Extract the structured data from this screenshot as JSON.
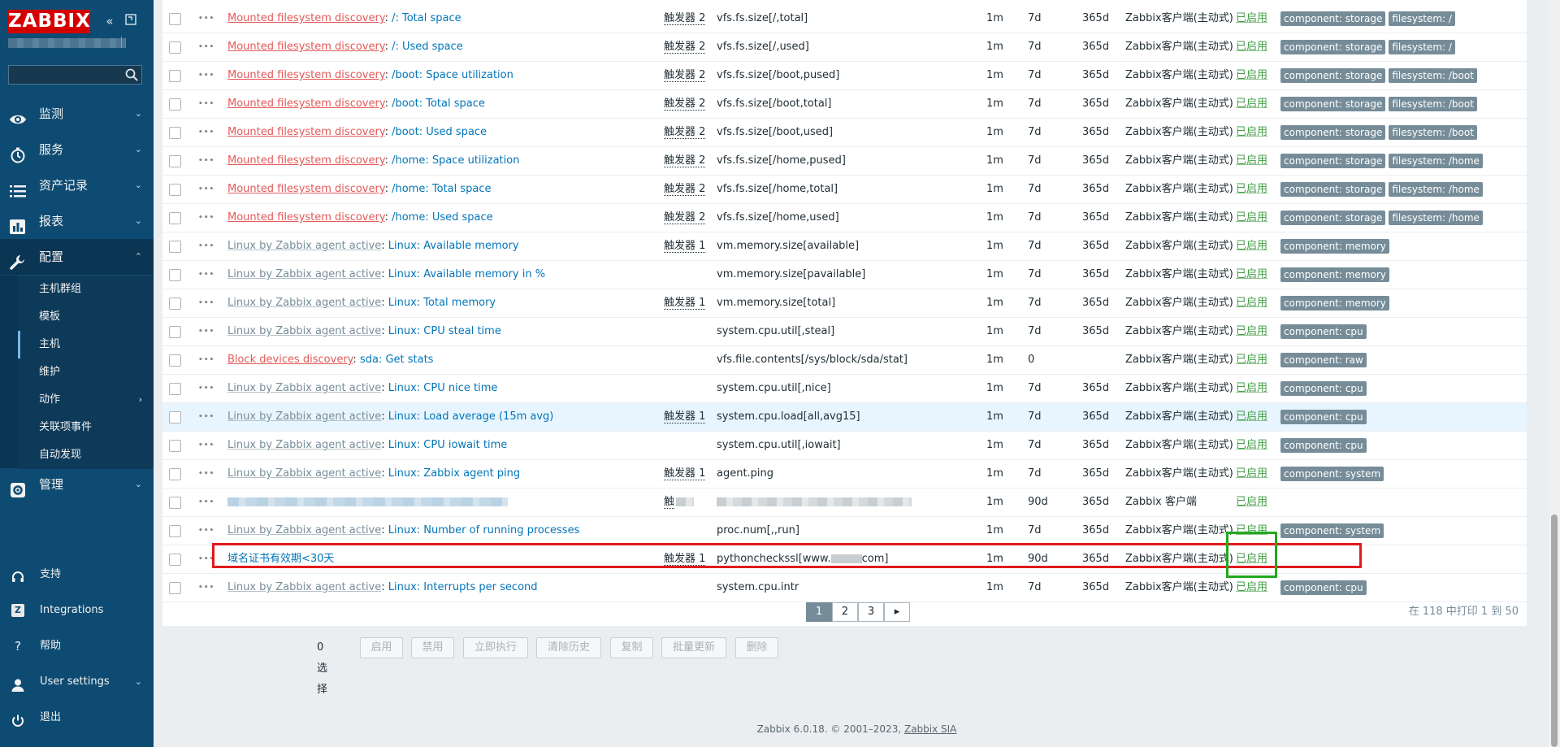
{
  "sidebar": {
    "logo": "ZABBIX",
    "nav": [
      {
        "label": "监测",
        "icon": "eye-icon"
      },
      {
        "label": "服务",
        "icon": "clock-icon"
      },
      {
        "label": "资产记录",
        "icon": "list-icon"
      },
      {
        "label": "报表",
        "icon": "bar-chart-icon"
      },
      {
        "label": "配置",
        "icon": "wrench-icon"
      },
      {
        "label": "管理",
        "icon": "gear-icon"
      }
    ],
    "config_submenu": [
      {
        "label": "主机群组"
      },
      {
        "label": "模板"
      },
      {
        "label": "主机"
      },
      {
        "label": "维护"
      },
      {
        "label": "动作"
      },
      {
        "label": "关联项事件"
      },
      {
        "label": "自动发现"
      }
    ],
    "bottom": [
      {
        "label": "支持",
        "icon": "headset-icon"
      },
      {
        "label": "Integrations",
        "icon": "z-logo-icon"
      },
      {
        "label": "帮助",
        "icon": "question-icon"
      },
      {
        "label": "User settings",
        "icon": "user-icon"
      },
      {
        "label": "退出",
        "icon": "power-icon"
      }
    ]
  },
  "rows": [
    {
      "prefix": "Mounted filesystem discovery",
      "prefix_color": "red",
      "name": "/: Total space",
      "triggers": "触发器 2",
      "key": "vfs.fs.size[/,total]",
      "interval": "1m",
      "history": "7d",
      "trends": "365d",
      "type": "Zabbix客户端(主动式)",
      "status": "已启用",
      "tags": [
        "component: storage",
        "filesystem: /"
      ]
    },
    {
      "prefix": "Mounted filesystem discovery",
      "prefix_color": "red",
      "name": "/: Used space",
      "triggers": "触发器 2",
      "key": "vfs.fs.size[/,used]",
      "interval": "1m",
      "history": "7d",
      "trends": "365d",
      "type": "Zabbix客户端(主动式)",
      "status": "已启用",
      "tags": [
        "component: storage",
        "filesystem: /"
      ]
    },
    {
      "prefix": "Mounted filesystem discovery",
      "prefix_color": "red",
      "name": "/boot: Space utilization",
      "triggers": "触发器 2",
      "key": "vfs.fs.size[/boot,pused]",
      "interval": "1m",
      "history": "7d",
      "trends": "365d",
      "type": "Zabbix客户端(主动式)",
      "status": "已启用",
      "tags": [
        "component: storage",
        "filesystem: /boot"
      ]
    },
    {
      "prefix": "Mounted filesystem discovery",
      "prefix_color": "red",
      "name": "/boot: Total space",
      "triggers": "触发器 2",
      "key": "vfs.fs.size[/boot,total]",
      "interval": "1m",
      "history": "7d",
      "trends": "365d",
      "type": "Zabbix客户端(主动式)",
      "status": "已启用",
      "tags": [
        "component: storage",
        "filesystem: /boot"
      ]
    },
    {
      "prefix": "Mounted filesystem discovery",
      "prefix_color": "red",
      "name": "/boot: Used space",
      "triggers": "触发器 2",
      "key": "vfs.fs.size[/boot,used]",
      "interval": "1m",
      "history": "7d",
      "trends": "365d",
      "type": "Zabbix客户端(主动式)",
      "status": "已启用",
      "tags": [
        "component: storage",
        "filesystem: /boot"
      ]
    },
    {
      "prefix": "Mounted filesystem discovery",
      "prefix_color": "red",
      "name": "/home: Space utilization",
      "triggers": "触发器 2",
      "key": "vfs.fs.size[/home,pused]",
      "interval": "1m",
      "history": "7d",
      "trends": "365d",
      "type": "Zabbix客户端(主动式)",
      "status": "已启用",
      "tags": [
        "component: storage",
        "filesystem: /home"
      ]
    },
    {
      "prefix": "Mounted filesystem discovery",
      "prefix_color": "red",
      "name": "/home: Total space",
      "triggers": "触发器 2",
      "key": "vfs.fs.size[/home,total]",
      "interval": "1m",
      "history": "7d",
      "trends": "365d",
      "type": "Zabbix客户端(主动式)",
      "status": "已启用",
      "tags": [
        "component: storage",
        "filesystem: /home"
      ]
    },
    {
      "prefix": "Mounted filesystem discovery",
      "prefix_color": "red",
      "name": "/home: Used space",
      "triggers": "触发器 2",
      "key": "vfs.fs.size[/home,used]",
      "interval": "1m",
      "history": "7d",
      "trends": "365d",
      "type": "Zabbix客户端(主动式)",
      "status": "已启用",
      "tags": [
        "component: storage",
        "filesystem: /home"
      ]
    },
    {
      "prefix": "Linux by Zabbix agent active",
      "prefix_color": "grey",
      "name": "Linux: Available memory",
      "triggers": "触发器 1",
      "key": "vm.memory.size[available]",
      "interval": "1m",
      "history": "7d",
      "trends": "365d",
      "type": "Zabbix客户端(主动式)",
      "status": "已启用",
      "tags": [
        "component: memory"
      ]
    },
    {
      "prefix": "Linux by Zabbix agent active",
      "prefix_color": "grey",
      "name": "Linux: Available memory in %",
      "triggers": "",
      "key": "vm.memory.size[pavailable]",
      "interval": "1m",
      "history": "7d",
      "trends": "365d",
      "type": "Zabbix客户端(主动式)",
      "status": "已启用",
      "tags": [
        "component: memory"
      ]
    },
    {
      "prefix": "Linux by Zabbix agent active",
      "prefix_color": "grey",
      "name": "Linux: Total memory",
      "triggers": "触发器 1",
      "key": "vm.memory.size[total]",
      "interval": "1m",
      "history": "7d",
      "trends": "365d",
      "type": "Zabbix客户端(主动式)",
      "status": "已启用",
      "tags": [
        "component: memory"
      ]
    },
    {
      "prefix": "Linux by Zabbix agent active",
      "prefix_color": "grey",
      "name": "Linux: CPU steal time",
      "triggers": "",
      "key": "system.cpu.util[,steal]",
      "interval": "1m",
      "history": "7d",
      "trends": "365d",
      "type": "Zabbix客户端(主动式)",
      "status": "已启用",
      "tags": [
        "component: cpu"
      ]
    },
    {
      "prefix": "Block devices discovery",
      "prefix_color": "red",
      "name": "sda: Get stats",
      "triggers": "",
      "key": "vfs.file.contents[/sys/block/sda/stat]",
      "interval": "1m",
      "history": "0",
      "trends": "",
      "type": "Zabbix客户端(主动式)",
      "status": "已启用",
      "tags": [
        "component: raw"
      ]
    },
    {
      "prefix": "Linux by Zabbix agent active",
      "prefix_color": "grey",
      "name": "Linux: CPU nice time",
      "triggers": "",
      "key": "system.cpu.util[,nice]",
      "interval": "1m",
      "history": "7d",
      "trends": "365d",
      "type": "Zabbix客户端(主动式)",
      "status": "已启用",
      "tags": [
        "component: cpu"
      ]
    },
    {
      "prefix": "Linux by Zabbix agent active",
      "prefix_color": "grey",
      "name": "Linux: Load average (15m avg)",
      "triggers": "触发器 1",
      "key": "system.cpu.load[all,avg15]",
      "interval": "1m",
      "history": "7d",
      "trends": "365d",
      "type": "Zabbix客户端(主动式)",
      "status": "已启用",
      "tags": [
        "component: cpu"
      ],
      "highlight": true
    },
    {
      "prefix": "Linux by Zabbix agent active",
      "prefix_color": "grey",
      "name": "Linux: CPU iowait time",
      "triggers": "",
      "key": "system.cpu.util[,iowait]",
      "interval": "1m",
      "history": "7d",
      "trends": "365d",
      "type": "Zabbix客户端(主动式)",
      "status": "已启用",
      "tags": [
        "component: cpu"
      ]
    },
    {
      "prefix": "Linux by Zabbix agent active",
      "prefix_color": "grey",
      "name": "Linux: Zabbix agent ping",
      "triggers": "触发器 1",
      "key": "agent.ping",
      "interval": "1m",
      "history": "7d",
      "trends": "365d",
      "type": "Zabbix客户端(主动式)",
      "status": "已启用",
      "tags": [
        "component: system"
      ]
    },
    {
      "prefix": "",
      "prefix_color": "blurred",
      "name": "",
      "triggers": "触",
      "key": "",
      "interval": "1m",
      "history": "90d",
      "trends": "365d",
      "type": "Zabbix 客户端",
      "status": "已启用",
      "tags": [],
      "blurred": true
    },
    {
      "prefix": "Linux by Zabbix agent active",
      "prefix_color": "grey",
      "name": "Linux: Number of running processes",
      "triggers": "",
      "key": "proc.num[,,run]",
      "interval": "1m",
      "history": "7d",
      "trends": "365d",
      "type": "Zabbix客户端(主动式)",
      "status": "已启用",
      "tags": [
        "component: system"
      ]
    },
    {
      "prefix": "",
      "prefix_color": "none",
      "name": "域名证书有效期<30天",
      "triggers": "触发器 1",
      "key_start": "pythoncheckssl[www.",
      "key_end": "com]",
      "interval": "1m",
      "history": "90d",
      "trends": "365d",
      "type": "Zabbix客户端(主动式)",
      "status": "已启用",
      "tags": []
    },
    {
      "prefix": "Linux by Zabbix agent active",
      "prefix_color": "grey",
      "name": "Linux: Interrupts per second",
      "triggers": "",
      "key": "system.cpu.intr",
      "interval": "1m",
      "history": "7d",
      "trends": "365d",
      "type": "Zabbix客户端(主动式)",
      "status": "已启用",
      "tags": [
        "component: cpu"
      ]
    }
  ],
  "pagination": {
    "pages": [
      "1",
      "2",
      "3"
    ],
    "current": "1",
    "next": "▸",
    "info": "在 118 中打印 1 到 50"
  },
  "mass_actions": {
    "selected": "0 选择",
    "buttons": [
      "启用",
      "禁用",
      "立即执行",
      "清除历史",
      "复制",
      "批量更新",
      "删除"
    ]
  },
  "footer": {
    "text": "Zabbix 6.0.18. © 2001–2023, ",
    "company": "Zabbix SIA"
  },
  "colors": {
    "sidebar": "#0e4b72",
    "status_enabled": "#429e47",
    "tag": "#768d99",
    "link": "#0275b8",
    "prefix_red": "#e45959",
    "annotation_red": "#e11b1b",
    "annotation_green": "#22a81f"
  }
}
